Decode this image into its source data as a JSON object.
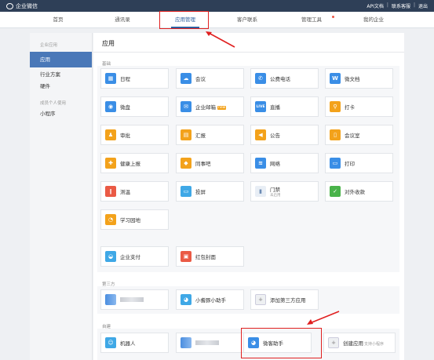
{
  "topbar": {
    "brand": "企业微信",
    "links": [
      "API文档",
      "联系客服",
      "退出"
    ]
  },
  "nav": {
    "tabs": [
      "首页",
      "通讯录",
      "应用管理",
      "客户联系",
      "管理工具",
      "我的企业"
    ],
    "active": "应用管理"
  },
  "sidebar": {
    "group1": "企业应用",
    "items1": [
      "应用",
      "行业方案",
      "硬件"
    ],
    "group2": "成员个人使用",
    "items2": [
      "小程序"
    ]
  },
  "main": {
    "title": "应用",
    "basic_label": "基础",
    "apps": [
      {
        "name": "日程",
        "icon": "calendar-icon",
        "color": "blue"
      },
      {
        "name": "会议",
        "icon": "meeting-cloud-icon",
        "color": "blue"
      },
      {
        "name": "公费电话",
        "icon": "phone-icon",
        "color": "blue"
      },
      {
        "name": "微文档",
        "icon": "doc-w-icon",
        "color": "blue"
      },
      {
        "name": "微盘",
        "icon": "disk-icon",
        "color": "blue"
      },
      {
        "name": "企业邮箱",
        "icon": "mail-icon",
        "color": "blue",
        "badge": "new"
      },
      {
        "name": "直播",
        "icon": "live-icon",
        "color": "blue"
      },
      {
        "name": "打卡",
        "icon": "checkin-icon",
        "color": "orange"
      },
      {
        "name": "审批",
        "icon": "stamp-icon",
        "color": "orange"
      },
      {
        "name": "汇报",
        "icon": "report-icon",
        "color": "orange"
      },
      {
        "name": "公告",
        "icon": "megaphone-icon",
        "color": "orange"
      },
      {
        "name": "会议室",
        "icon": "door-icon",
        "color": "orange"
      },
      {
        "name": "健康上报",
        "icon": "health-icon",
        "color": "orange"
      },
      {
        "name": "同事吧",
        "icon": "bar-icon",
        "color": "orange"
      },
      {
        "name": "网络",
        "icon": "wifi-icon",
        "color": "blue"
      },
      {
        "name": "打印",
        "icon": "printer-icon",
        "color": "blue"
      },
      {
        "name": "测温",
        "icon": "thermometer-icon",
        "color": "red"
      },
      {
        "name": "投屏",
        "icon": "screen-icon",
        "color": "sky"
      },
      {
        "name": "门禁",
        "sub": "未启用",
        "icon": "gate-icon",
        "color": "light"
      },
      {
        "name": "对外收款",
        "icon": "payment-icon",
        "color": "green"
      },
      {
        "name": "学习园地",
        "icon": "learning-icon",
        "color": "orange"
      }
    ],
    "pay_apps": [
      {
        "name": "企业支付",
        "icon": "pay-icon",
        "color": "sky"
      },
      {
        "name": "红包封面",
        "icon": "redpacket-icon",
        "color": "red"
      }
    ],
    "third_label": "第三方",
    "third_apps": [
      {
        "name": "小耆豚小助手",
        "icon": "assistant-icon",
        "color": "sky"
      },
      {
        "name": "添加第三方应用",
        "icon": "plus-icon",
        "color": "gray"
      }
    ],
    "custom_label": "自建",
    "custom_apps": [
      {
        "name": "机器人",
        "icon": "robot-icon",
        "color": "sky"
      },
      {
        "name": "微客助手",
        "icon": "chat-bubble-icon",
        "color": "blue"
      },
      {
        "name": "创建应用",
        "hint": "支持小程序",
        "icon": "plus-icon",
        "color": "gray"
      }
    ]
  },
  "annotation_color": "#e02020"
}
